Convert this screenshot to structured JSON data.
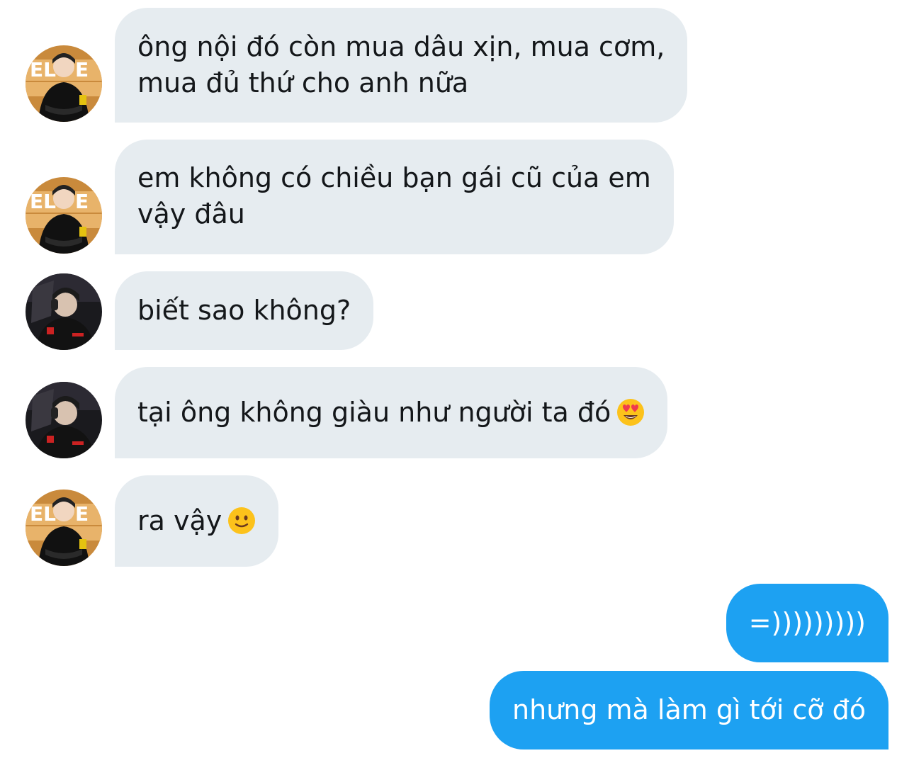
{
  "colors": {
    "incoming_bubble": "#e6ecf0",
    "outgoing_bubble": "#1da1f2",
    "incoming_text": "#14171a",
    "outgoing_text": "#ffffff"
  },
  "messages": [
    {
      "direction": "incoming",
      "avatar": "avatar-orange-backdrop",
      "line1": "ông nội đó còn mua dâu xịn, mua cơm,",
      "line2": "mua đủ thứ cho anh nữa"
    },
    {
      "direction": "incoming",
      "avatar": "avatar-orange-backdrop",
      "line1": "em không có chiều bạn gái cũ của em",
      "line2": "vậy đâu"
    },
    {
      "direction": "incoming",
      "avatar": "avatar-dark-backdrop",
      "text": "biết sao không?"
    },
    {
      "direction": "incoming",
      "avatar": "avatar-dark-backdrop",
      "text": "tại ông không giàu như người ta đó",
      "emoji": "heart-eyes-emoji"
    },
    {
      "direction": "incoming",
      "avatar": "avatar-orange-backdrop",
      "text": "ra vậy",
      "emoji": "slight-smile-emoji"
    },
    {
      "direction": "outgoing",
      "text": "=)))))))))"
    },
    {
      "direction": "outgoing",
      "text": "nhưng mà làm gì tới cỡ đó"
    }
  ]
}
